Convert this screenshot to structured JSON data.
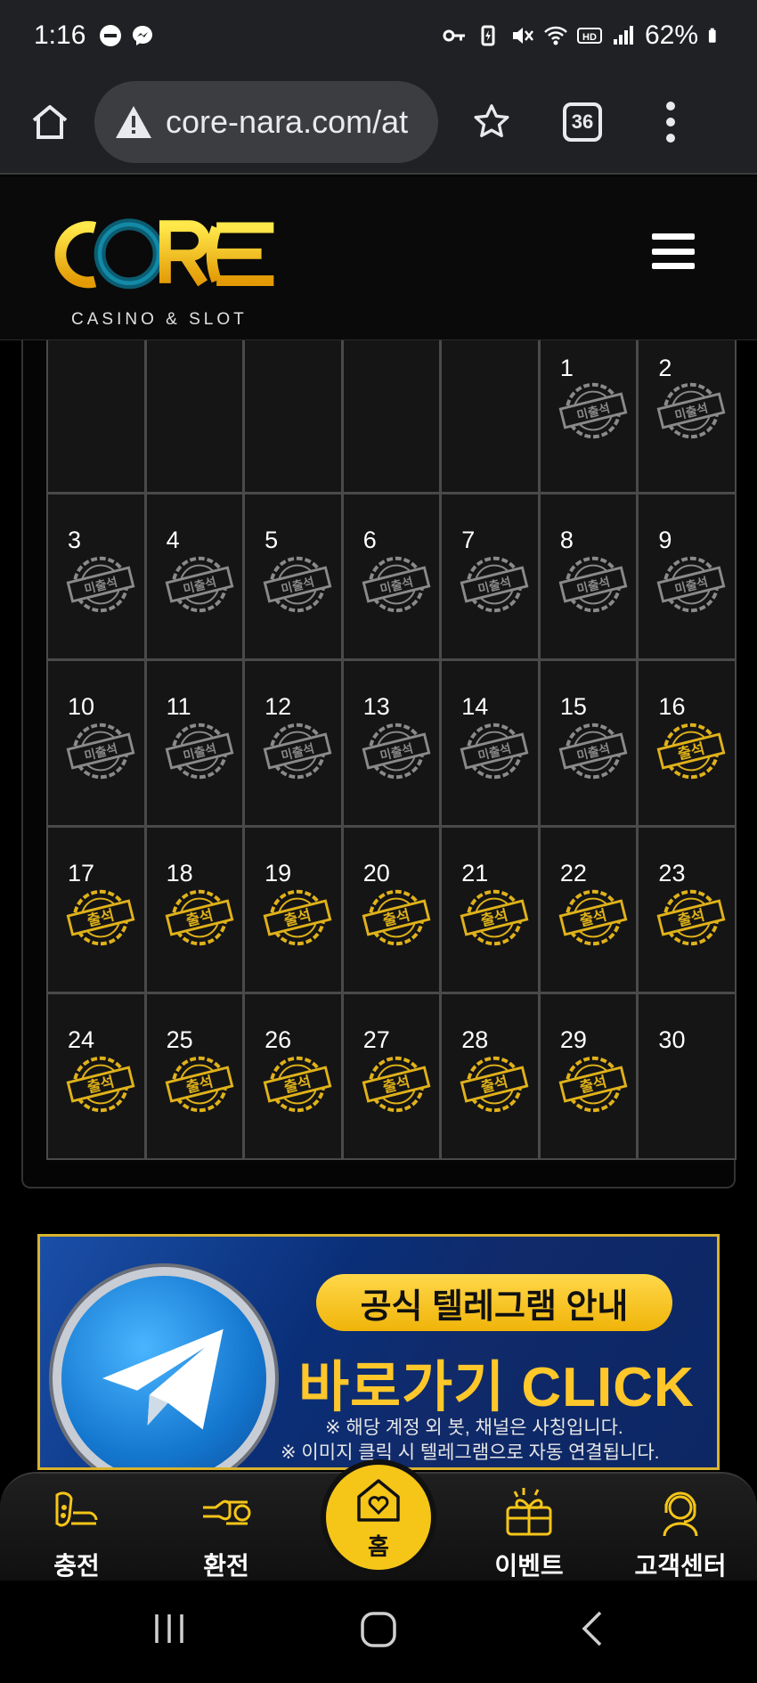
{
  "status_bar": {
    "time": "1:16",
    "battery": "62%"
  },
  "browser": {
    "url": "core-nara.com/at",
    "tab_count": "36"
  },
  "site": {
    "logo_text": "CORE",
    "logo_subtitle": "CASINO & SLOT"
  },
  "calendar": {
    "absent_label": "미출석",
    "present_label": "출석",
    "leading_blanks": 5,
    "days": [
      {
        "day": "1",
        "status": "absent"
      },
      {
        "day": "2",
        "status": "absent"
      },
      {
        "day": "3",
        "status": "absent"
      },
      {
        "day": "4",
        "status": "absent"
      },
      {
        "day": "5",
        "status": "absent"
      },
      {
        "day": "6",
        "status": "absent"
      },
      {
        "day": "7",
        "status": "absent"
      },
      {
        "day": "8",
        "status": "absent"
      },
      {
        "day": "9",
        "status": "absent"
      },
      {
        "day": "10",
        "status": "absent"
      },
      {
        "day": "11",
        "status": "absent"
      },
      {
        "day": "12",
        "status": "absent"
      },
      {
        "day": "13",
        "status": "absent"
      },
      {
        "day": "14",
        "status": "absent"
      },
      {
        "day": "15",
        "status": "absent"
      },
      {
        "day": "16",
        "status": "present"
      },
      {
        "day": "17",
        "status": "present"
      },
      {
        "day": "18",
        "status": "present"
      },
      {
        "day": "19",
        "status": "present"
      },
      {
        "day": "20",
        "status": "present"
      },
      {
        "day": "21",
        "status": "present"
      },
      {
        "day": "22",
        "status": "present"
      },
      {
        "day": "23",
        "status": "present"
      },
      {
        "day": "24",
        "status": "present"
      },
      {
        "day": "25",
        "status": "present"
      },
      {
        "day": "26",
        "status": "present"
      },
      {
        "day": "27",
        "status": "present"
      },
      {
        "day": "28",
        "status": "present"
      },
      {
        "day": "29",
        "status": "present"
      },
      {
        "day": "30",
        "status": "none"
      }
    ]
  },
  "banner": {
    "pill_text": "공식 텔레그램 안내",
    "cta_text": "바로가기 CLICK",
    "note1": "※ 해당 계정 외 봇, 채널은 사칭입니다.",
    "note2": "※ 이미지 클릭 시 텔레그램으로 자동 연결됩니다."
  },
  "bottom_nav": {
    "deposit": "충전",
    "withdraw": "환전",
    "home": "홈",
    "event": "이벤트",
    "support": "고객센터"
  },
  "colors": {
    "gold": "#f5c518",
    "stamp_absent": "#8a8a8a",
    "stamp_present": "#e0b21a"
  }
}
